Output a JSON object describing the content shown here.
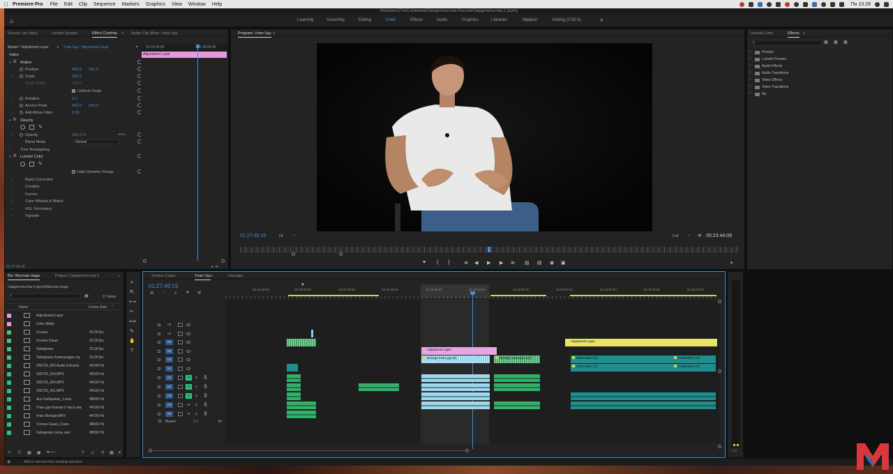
{
  "menubar": {
    "app_name": "Premiere Pro",
    "items": [
      "File",
      "Edit",
      "Clip",
      "Sequence",
      "Markers",
      "Graphics",
      "View",
      "Window",
      "Help"
    ],
    "clock": "Пн 10:28"
  },
  "window": {
    "title": "/Volumes/2Tb/Служение/Свидетельства Россия/Свидетельства 2.prproj"
  },
  "workspaces": {
    "tabs": [
      "Learning",
      "Assembly",
      "Editing",
      "Color",
      "Effects",
      "Audio",
      "Graphics",
      "Libraries",
      "Эффект",
      "Editing (CS5.5)"
    ],
    "active": "Color"
  },
  "left_top_panel": {
    "tabs": [
      "Source: (no clips)",
      "Lumetri Scopes",
      "Effect Controls",
      "Audio Clip Mixer: Улан-Удэ"
    ],
    "active_tab": "Effect Controls",
    "clip_selector": "Master * Adjustment Layer",
    "sequence_selector": "Улан-Удэ * Adjustment Layer",
    "time_start": "01:15:00:00",
    "time_end": "01:30:00:00",
    "clip_bar_label": "Adjustment Layer",
    "timecode": "01:27:49:19",
    "rows": {
      "video": "Video",
      "motion": "Motion",
      "position": "Position",
      "position_x": "960,0",
      "position_y": "540,0",
      "scale": "Scale",
      "scale_val": "100,0",
      "scale_width": "Scale Width",
      "scale_width_val": "100,0",
      "uniform_scale": "Uniform Scale",
      "rotation": "Rotation",
      "rotation_val": "0,0",
      "anchor_point": "Anchor Point",
      "anchor_x": "960,0",
      "anchor_y": "540,0",
      "anti_flicker": "Anti-flicker Filter",
      "anti_flicker_val": "0,00",
      "opacity_group": "Opacity",
      "opacity": "Opacity",
      "opacity_val": "100,0 %",
      "blend_mode": "Blend Mode",
      "blend_mode_val": "Normal",
      "time_remapping": "Time Remapping",
      "lumetri": "Lumetri Color",
      "hdr": "High Dynamic Range",
      "basic_correction": "Basic Correction",
      "creative": "Creative",
      "curves": "Curves",
      "color_wheels": "Color Wheels & Match",
      "hsl": "HSL Secondary",
      "vignette": "Vignette"
    }
  },
  "program_monitor": {
    "tab": "Program: Улан-Удэ",
    "timecode": "01:27:49:19",
    "fit": "Fit",
    "quality": "Full",
    "duration": "00:23:44:09"
  },
  "right_panel": {
    "tabs": [
      "Lumetri Color",
      "Effects"
    ],
    "active_tab": "Effects",
    "items": [
      "Presets",
      "Lumetri Presets",
      "Audio Effects",
      "Audio Transitions",
      "Video Effects",
      "Video Transitions",
      "My"
    ]
  },
  "project_panel": {
    "tabs": [
      "Bin: Монтаж люди",
      "Project: Свидетельства 2"
    ],
    "active_tab": "Bin: Монтаж люди",
    "path": "Свидетельства 2.prproj\\Монтаж люди",
    "count": "17 Items",
    "col_name": "Name",
    "col_rate": "Frame Rate",
    "items": [
      {
        "name": "Adjustment Layer",
        "rate": "",
        "color": "#e59ae0"
      },
      {
        "name": "Color Matte",
        "rate": "",
        "color": "#e59ae0"
      },
      {
        "name": "Усолье",
        "rate": "25,00 fps",
        "color": "#4fbf6c"
      },
      {
        "name": "Усолье Саша",
        "rate": "25,00 fps",
        "color": "#4fbf6c"
      },
      {
        "name": "Хабаровск",
        "rate": "25,00 fps",
        "color": "#4fbf6c"
      },
      {
        "name": "Хабаровск Александра слу",
        "rate": "25,00 fps",
        "color": "#4fbf6c"
      },
      {
        "name": "200723_003 Audio Extracte",
        "rate": "44100 Hz",
        "color": "#2fc27c"
      },
      {
        "name": "200723_003.MP3",
        "rate": "44100 Hz",
        "color": "#2fc27c"
      },
      {
        "name": "200723_004.MP3",
        "rate": "44100 Hz",
        "color": "#2fc27c"
      },
      {
        "name": "200723_001.MP3",
        "rate": "44100 Hz",
        "color": "#2fc27c"
      },
      {
        "name": "Ася Хабаровск_1.wav",
        "rate": "48000 Hz",
        "color": "#2fc27c"
      },
      {
        "name": "Улан уде Ксения 2 часть.ма",
        "rate": "44100 Hz",
        "color": "#2fc27c"
      },
      {
        "name": "Улан Володя.MP3",
        "rate": "44100 Hz",
        "color": "#2fc27c"
      },
      {
        "name": "Усолье Саша_2.wav",
        "rate": "48000 Hz",
        "color": "#2fc27c"
      },
      {
        "name": "Хабаровск огонь.wav",
        "rate": "48000 Hz",
        "color": "#2fc27c"
      }
    ]
  },
  "timeline": {
    "tabs": [
      "Усолье Саша",
      "Улан-Удэ",
      "Находка"
    ],
    "active_tab": "Улан-Удэ",
    "timecode": "01:27:49:19",
    "ruler": [
      "00:15:00:00",
      "00:30:00:00",
      "00:45:00:00",
      "01:00:00:00",
      "01:15:00:00",
      "01:30:00:00",
      "01:45:00:00",
      "02:00:00:00",
      "02:15:00:00",
      "02:30:00:00",
      "02:45:00:00"
    ],
    "video_tracks": [
      "V6",
      "V5",
      "V4",
      "V3",
      "V2",
      "V1"
    ],
    "audio_tracks": [
      "A1",
      "A2",
      "A3",
      "A4",
      "A5"
    ],
    "master": "Master",
    "master_val": "0,0",
    "mute": "M",
    "solo": "S",
    "clip_labels": {
      "adj1": "Adjustment Layer",
      "adj2": "Adjustment Layer",
      "volodya1": "Володя Улан-удэ [V]",
      "volodya2": "Володя улан-удэ 2 [V]",
      "c0001a": "C0001.MP4 [V]",
      "c0001b": "C0001.MP4 [V]",
      "c0002a": "C0002.MP4 [V]",
      "c0002b": "C0002.MP4 [V]"
    }
  },
  "status": {
    "hint": "Add or remove from existing selection."
  },
  "vu": {
    "label": "S S"
  },
  "colors": {
    "accent_blue": "#3f8fd6",
    "adjustment_pink": "#e7a6e3",
    "adjustment_yellow": "#e8e46a",
    "clip_green": "#3fa764",
    "clip_teal": "#1f8f8e",
    "clip_blue": "#8fd3ef"
  }
}
